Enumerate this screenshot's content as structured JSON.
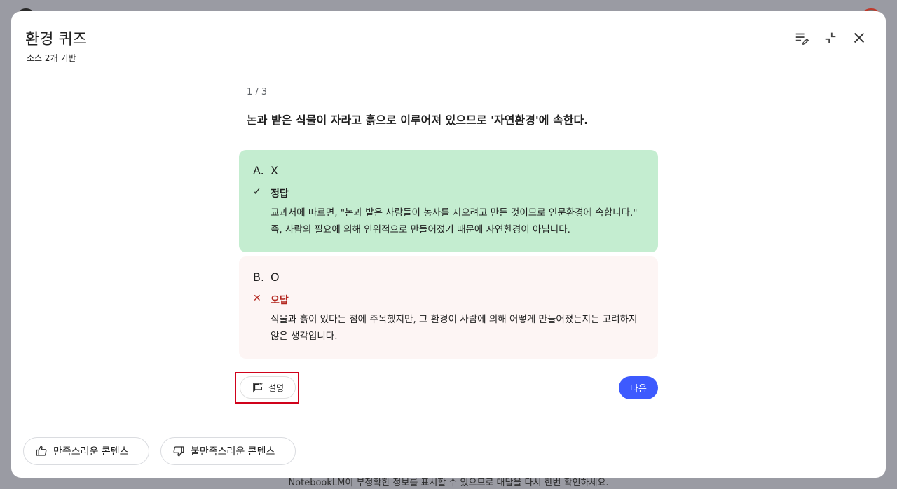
{
  "dialog": {
    "title": "환경 퀴즈",
    "subtitle": "소스 2개 기반"
  },
  "quiz": {
    "counter": "1 / 3",
    "question": "논과 밭은 식물이 자라고 흙으로 이루어져 있으므로 '자연환경'에 속한다.",
    "options": [
      {
        "letter": "A.",
        "text": "X",
        "mark": "✓",
        "status": "정답",
        "explanation": "교과서에 따르면, \"논과 밭은 사람들이 농사를 지으려고 만든 것이므로 인문환경에 속합니다.\" 즉, 사람의 필요에 의해 인위적으로 만들어졌기 때문에 자연환경이 아닙니다."
      },
      {
        "letter": "B.",
        "text": "O",
        "mark": "✕",
        "status": "오답",
        "explanation": "식물과 흙이 있다는 점에 주목했지만, 그 환경이 사람에 의해 어떻게 만들어졌는지는 고려하지 않은 생각입니다."
      }
    ],
    "explain_label": "설명",
    "next_label": "다음"
  },
  "feedback": {
    "good_label": "만족스러운 콘텐츠",
    "bad_label": "불만족스러운 콘텐츠"
  },
  "background": {
    "footer_note": "NotebookLM이 부정확한 정보를 표시할 수 있으므로 대답을 다시 한번 확인하세요."
  },
  "colors": {
    "correct_bg": "#c4edd0",
    "wrong_bg": "#fdf5f4",
    "wrong_text": "#b3261e",
    "primary": "#3d5afe"
  },
  "icons": {
    "header": [
      "edit-list-icon",
      "collapse-icon",
      "close-icon"
    ],
    "explain": "comment-sparkle-icon",
    "feedback": [
      "thumbs-up-icon",
      "thumbs-down-icon"
    ]
  }
}
